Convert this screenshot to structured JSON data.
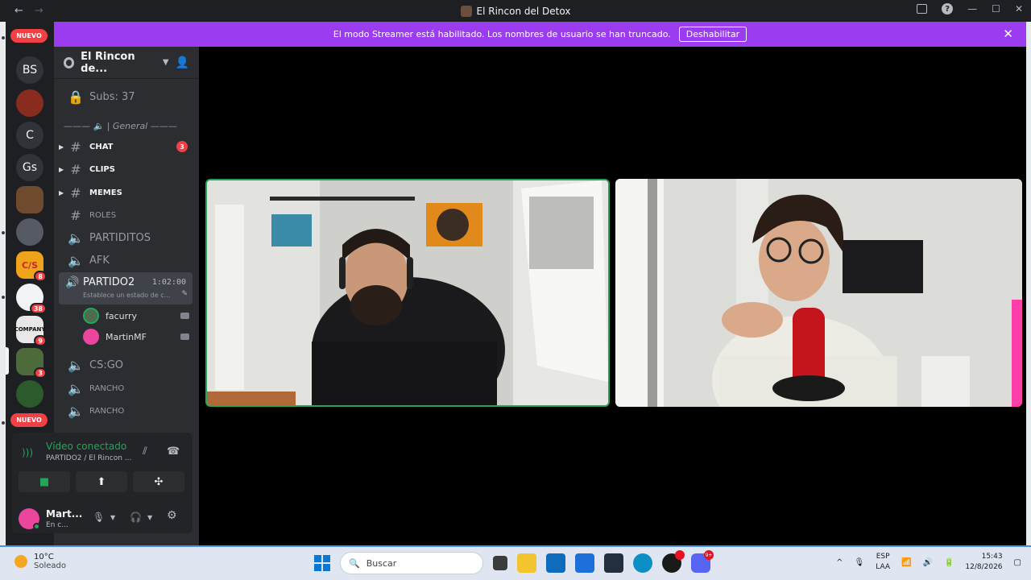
{
  "window": {
    "title": "El Rincon del Detox",
    "back": "←",
    "forward": "→",
    "minimize": "—",
    "maximize": "☐",
    "close": "✕"
  },
  "banner": {
    "message": "El modo Streamer está habilitado. Los nombres de usuario se han truncado.",
    "button": "Deshabilitar",
    "close": "✕"
  },
  "rail": {
    "new_top": "NUEVO",
    "new_bottom": "NUEVO",
    "servers": [
      {
        "label": "BS",
        "badge": ""
      },
      {
        "label": "",
        "badge": ""
      },
      {
        "label": "C",
        "badge": ""
      },
      {
        "label": "Gs",
        "badge": ""
      },
      {
        "label": "",
        "badge": ""
      },
      {
        "label": "",
        "badge": ""
      },
      {
        "label": "",
        "badge": "8"
      },
      {
        "label": "",
        "badge": "38"
      },
      {
        "label": "",
        "badge": "9"
      },
      {
        "label": "",
        "badge": "3"
      },
      {
        "label": "",
        "badge": ""
      }
    ]
  },
  "sidebar": {
    "guild_name": "El Rincon de...",
    "subs": "Subs: 37",
    "category": "——— 🔈 | General ——— ",
    "channels": [
      {
        "name": "CHAT",
        "count": "3"
      },
      {
        "name": "CLIPS"
      },
      {
        "name": "MEMES"
      },
      {
        "name": "ROLES"
      },
      {
        "name": "PARTIDITOS"
      },
      {
        "name": "AFK"
      },
      {
        "name": "CS:GO"
      },
      {
        "name": "RANCHO"
      },
      {
        "name": "RANCHO"
      }
    ],
    "active_voice": {
      "name": "PARTIDO2",
      "time": "1:02:00",
      "status": "Establece un estado de c..."
    },
    "voice_users": [
      "facurry",
      "MartinMF"
    ]
  },
  "voice_panel": {
    "title": "Vídeo conectado",
    "subtitle": "PARTIDO2 / El Rincon ...",
    "user_name": "Mart...",
    "user_status": "En c..."
  },
  "taskbar": {
    "temp": "10°C",
    "weather": "Soleado",
    "search_placeholder": "Buscar",
    "lang_1": "ESP",
    "lang_2": "LAA",
    "time": "15:43",
    "date": "12/8/2026",
    "discord_badge": "9+"
  },
  "colors": {
    "streamer_banner": "#9b3cf0",
    "connected_green": "#23a55a",
    "badge_red": "#f23f43"
  }
}
